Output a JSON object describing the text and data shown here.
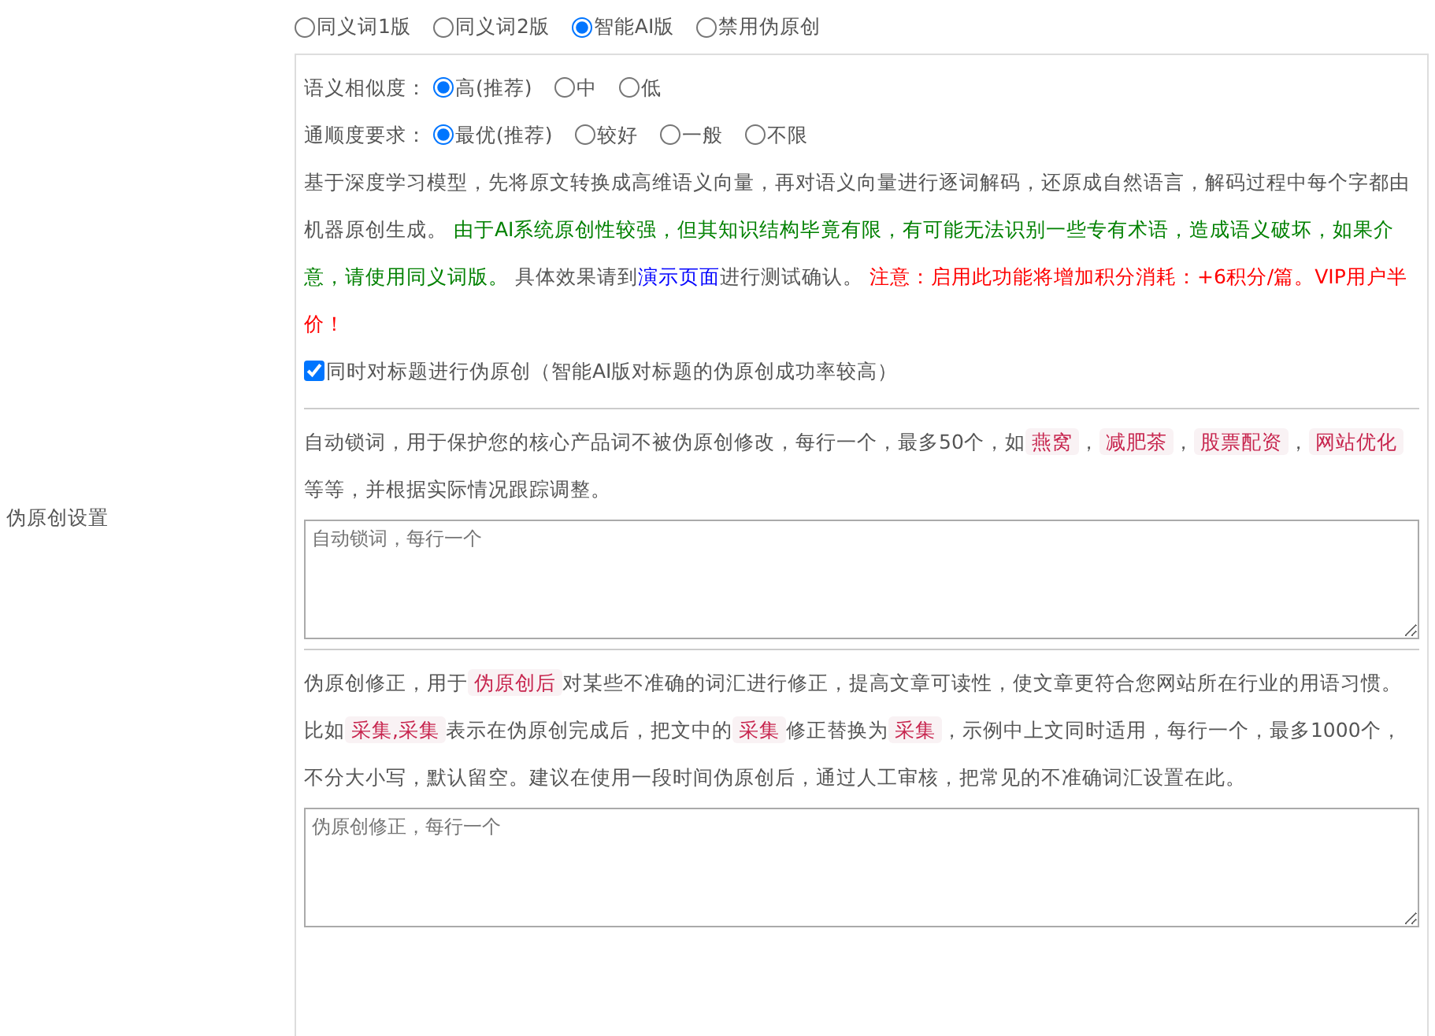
{
  "setting_label": "伪原创设置",
  "versions": [
    {
      "label": "同义词1版",
      "selected": false
    },
    {
      "label": "同义词2版",
      "selected": false
    },
    {
      "label": "智能AI版",
      "selected": true
    },
    {
      "label": "禁用伪原创",
      "selected": false
    }
  ],
  "similarity": {
    "label": "语义相似度：",
    "options": [
      {
        "label": "高(推荐)",
        "selected": true
      },
      {
        "label": "中",
        "selected": false
      },
      {
        "label": "低",
        "selected": false
      }
    ]
  },
  "fluency": {
    "label": "通顺度要求：",
    "options": [
      {
        "label": "最优(推荐)",
        "selected": true
      },
      {
        "label": "较好",
        "selected": false
      },
      {
        "label": "一般",
        "selected": false
      },
      {
        "label": "不限",
        "selected": false
      }
    ]
  },
  "description": [
    {
      "kind": "text",
      "text": "基于深度学习模型，先将原文转换成高维语义向量，再对语义向量进行逐词解码，还原成自然语言，解码过程中每个字都由机器原创生成。 "
    },
    {
      "kind": "green",
      "text": "由于AI系统原创性较强，但其知识结构毕竟有限，有可能无法识别一些专有术语，造成语义破坏，如果介意，请使用同义词版。"
    },
    {
      "kind": "text",
      "text": " 具体效果请到"
    },
    {
      "kind": "link",
      "text": "演示页面"
    },
    {
      "kind": "text",
      "text": "进行测试确认。 "
    },
    {
      "kind": "red",
      "text": "注意：启用此功能将增加积分消耗：+6积分/篇。VIP用户半价！"
    }
  ],
  "title_checkbox": {
    "label": "同时对标题进行伪原创（智能AI版对标题的伪原创成功率较高）",
    "checked": true
  },
  "lock_words": {
    "description": [
      {
        "kind": "text",
        "text": "自动锁词，用于保护您的核心产品词不被伪原创修改，每行一个，最多50个，如"
      },
      {
        "kind": "code",
        "text": "燕窝"
      },
      {
        "kind": "text",
        "text": "，"
      },
      {
        "kind": "code",
        "text": "减肥茶"
      },
      {
        "kind": "text",
        "text": "，"
      },
      {
        "kind": "code",
        "text": "股票配资"
      },
      {
        "kind": "text",
        "text": "，"
      },
      {
        "kind": "code",
        "text": "网站优化"
      },
      {
        "kind": "text",
        "text": " 等等，并根据实际情况跟踪调整。"
      }
    ],
    "placeholder": "自动锁词，每行一个"
  },
  "correction": {
    "description": [
      {
        "kind": "text",
        "text": "伪原创修正，用于"
      },
      {
        "kind": "code",
        "text": "伪原创后"
      },
      {
        "kind": "text",
        "text": "对某些不准确的词汇进行修正，提高文章可读性，使文章更符合您网站所在行业的用语习惯。比如"
      },
      {
        "kind": "code",
        "text": "采集,采集"
      },
      {
        "kind": "text",
        "text": "表示在伪原创完成后，把文中的"
      },
      {
        "kind": "code",
        "text": "采集"
      },
      {
        "kind": "text",
        "text": "修正替换为"
      },
      {
        "kind": "code",
        "text": "采集"
      },
      {
        "kind": "text",
        "text": "，示例中上文同时适用，每行一个，最多1000个，不分大小写，默认留空。建议在使用一段时间伪原创后，通过人工审核，把常见的不准确词汇设置在此。"
      }
    ],
    "placeholder": "伪原创修正，每行一个"
  }
}
